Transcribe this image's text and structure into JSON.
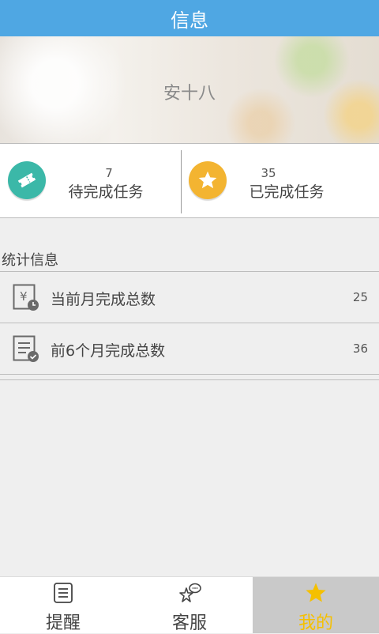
{
  "header": {
    "title": "信息"
  },
  "profile": {
    "name": "安十八"
  },
  "stats": {
    "pending": {
      "count": "7",
      "label": "待完成任务",
      "icon": "ticket-icon",
      "color": "#3bb8a8"
    },
    "done": {
      "count": "35",
      "label": "已完成任务",
      "icon": "star-icon",
      "color": "#f3b431"
    }
  },
  "section": {
    "title": "统计信息"
  },
  "list": [
    {
      "label": "当前月完成总数",
      "value": "25",
      "icon": "yuan-clock-icon"
    },
    {
      "label": "前6个月完成总数",
      "value": "36",
      "icon": "document-check-icon"
    }
  ],
  "tabs": [
    {
      "label": "提醒",
      "icon": "list-icon",
      "active": false
    },
    {
      "label": "客服",
      "icon": "chat-icon",
      "active": false
    },
    {
      "label": "我的",
      "icon": "star-icon",
      "active": true
    }
  ],
  "colors": {
    "header": "#4fa7e3",
    "active_tab_text": "#f5c000",
    "active_tab_bg": "#c9c9c9"
  }
}
